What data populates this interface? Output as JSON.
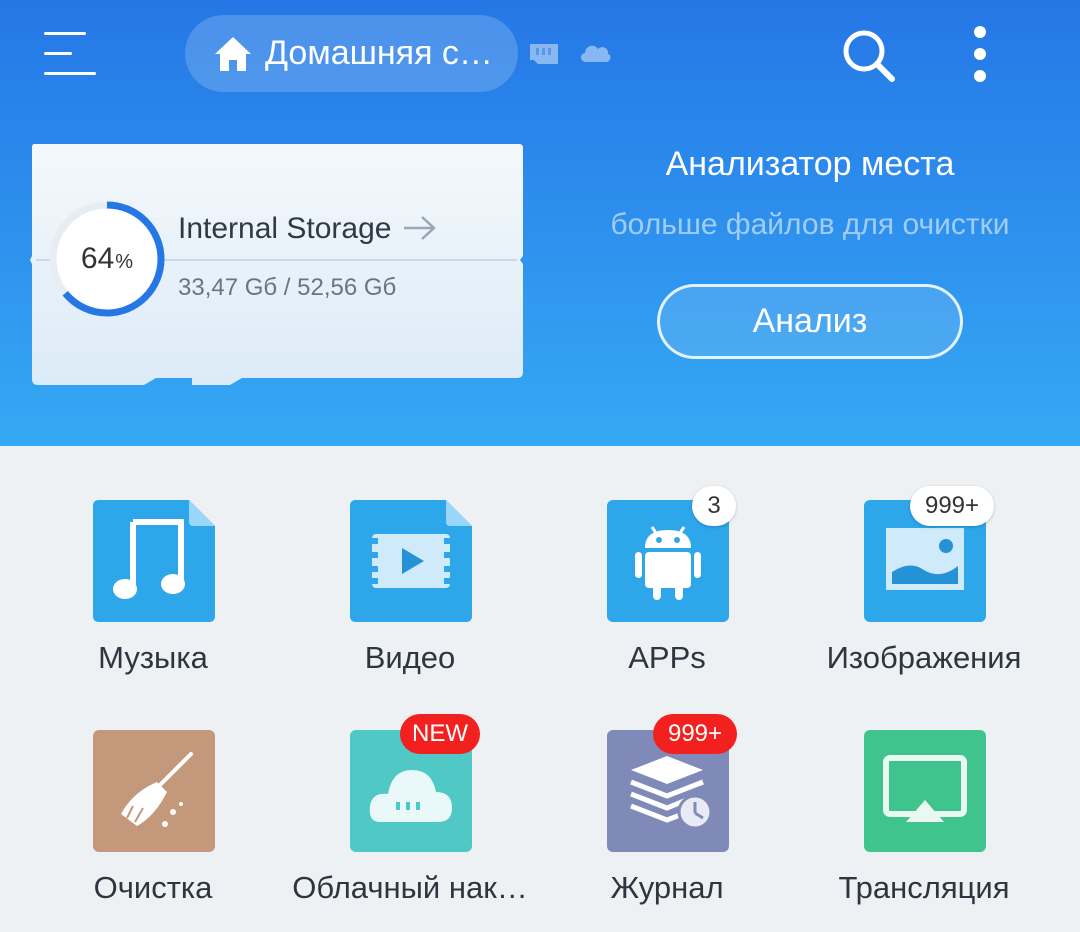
{
  "topbar": {
    "location": "Домашняя с…",
    "icons": {
      "menu": "hamburger-menu-icon",
      "home": "home-icon",
      "sd": "sd-card-icon",
      "cloud": "cloud-icon",
      "search": "search-icon",
      "more": "more-vertical-icon"
    }
  },
  "storage": {
    "name": "Internal Storage",
    "percent_value": 64,
    "percent_num": "64",
    "percent_sign": "%",
    "usage": "33,47 Gб / 52,56 Gб"
  },
  "analyzer": {
    "title": "Анализатор места",
    "subtitle": "больше файлов для очистки",
    "button": "Анализ"
  },
  "categories": [
    {
      "label": "Музыка",
      "icon": "music-icon",
      "badge": ""
    },
    {
      "label": "Видео",
      "icon": "video-icon",
      "badge": ""
    },
    {
      "label": "APPs",
      "icon": "android-icon",
      "badge": "3"
    },
    {
      "label": "Изображения",
      "icon": "image-icon",
      "badge": "999+"
    },
    {
      "label": "Очистка",
      "icon": "broom-icon",
      "badge": ""
    },
    {
      "label": "Облачный нак…",
      "icon": "cloud-storage-icon",
      "badge": "NEW"
    },
    {
      "label": "Журнал",
      "icon": "history-icon",
      "badge": "999+"
    },
    {
      "label": "Трансляция",
      "icon": "cast-icon",
      "badge": ""
    }
  ],
  "colors": {
    "accent": "#2577e6",
    "music": "#2ea6ea",
    "video": "#2ea6ea",
    "apps": "#2ea6ea",
    "images": "#2ea6ea",
    "clean": "#c4987a",
    "cloud": "#4fc8c6",
    "history": "#7f8ab8",
    "cast": "#3fc48e",
    "badge_red": "#f2201f"
  }
}
